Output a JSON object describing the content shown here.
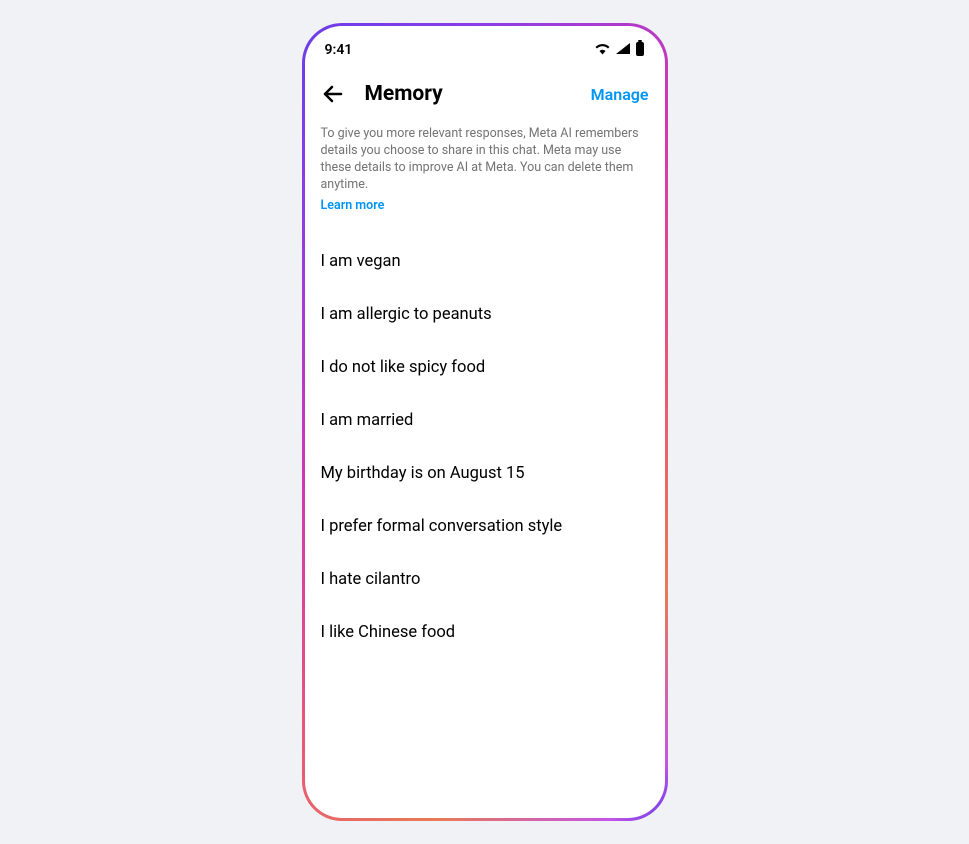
{
  "statusBar": {
    "time": "9:41"
  },
  "header": {
    "title": "Memory",
    "manageLabel": "Manage"
  },
  "description": {
    "text": "To give you more relevant responses, Meta AI remembers details you choose to share in this chat. Meta may use these details to improve AI at Meta. You can delete them anytime.",
    "learnMoreLabel": "Learn more"
  },
  "memories": [
    "I am vegan",
    "I am allergic to peanuts",
    "I do not like spicy food",
    "I am married",
    "My birthday is on August 15",
    "I prefer formal conversation style",
    "I hate cilantro",
    "I like Chinese food"
  ]
}
